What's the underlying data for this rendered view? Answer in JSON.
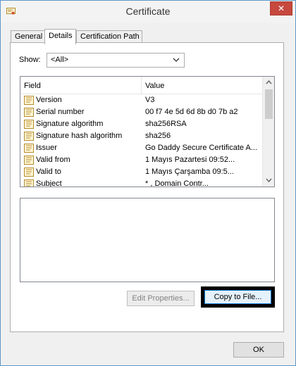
{
  "window": {
    "title": "Certificate",
    "close_label": "✕"
  },
  "tabs": [
    {
      "label": "General"
    },
    {
      "label": "Details"
    },
    {
      "label": "Certification Path"
    }
  ],
  "show": {
    "label": "Show:",
    "value": "<All>"
  },
  "list": {
    "headers": {
      "field": "Field",
      "value": "Value"
    },
    "rows": [
      {
        "field": "Version",
        "value": "V3"
      },
      {
        "field": "Serial number",
        "value": "00 f7 4e 5d 6d 8b d0 7b a2"
      },
      {
        "field": "Signature algorithm",
        "value": "sha256RSA"
      },
      {
        "field": "Signature hash algorithm",
        "value": "sha256"
      },
      {
        "field": "Issuer",
        "value": "Go Daddy Secure Certificate A..."
      },
      {
        "field": "Valid from",
        "value": "1   Mayıs          Pazartesi 09:52..."
      },
      {
        "field": "Valid to",
        "value": "1   Mayıs          Çarşamba 09:5..."
      },
      {
        "field": "Subject",
        "value": "*          ,        Domain Contr..."
      }
    ]
  },
  "buttons": {
    "edit_properties": "Edit Properties...",
    "copy_to_file": "Copy to File...",
    "ok": "OK"
  }
}
